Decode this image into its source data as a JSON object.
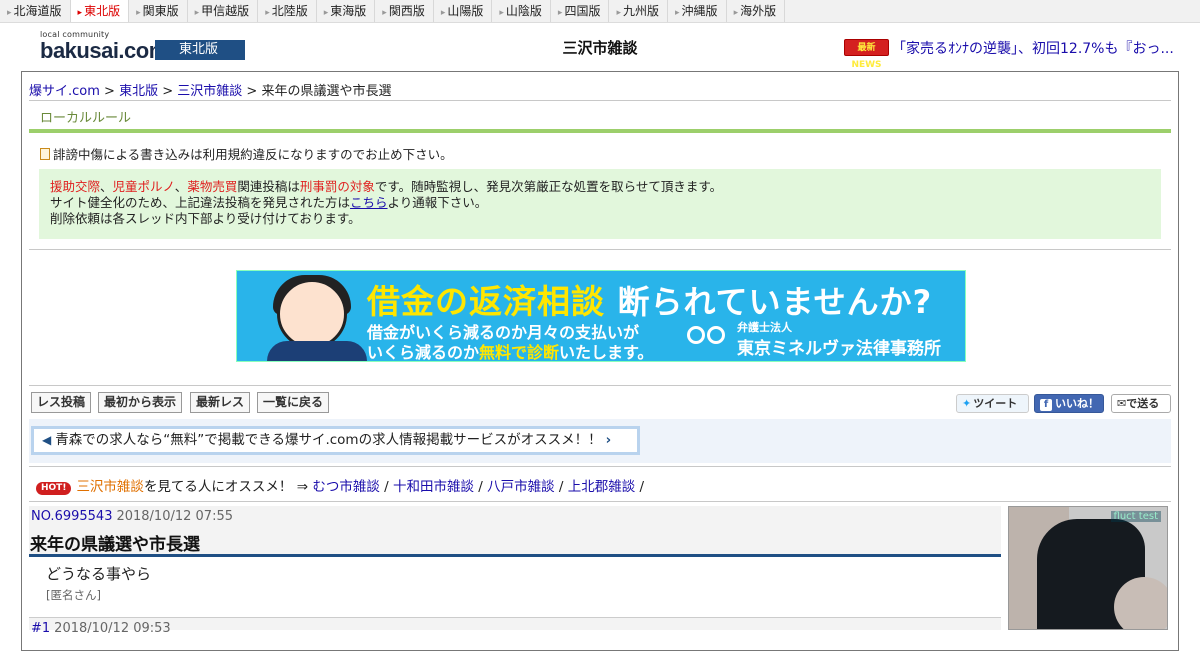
{
  "regions": [
    {
      "label": "北海道版",
      "active": false
    },
    {
      "label": "東北版",
      "active": true
    },
    {
      "label": "関東版",
      "active": false
    },
    {
      "label": "甲信越版",
      "active": false
    },
    {
      "label": "北陸版",
      "active": false
    },
    {
      "label": "東海版",
      "active": false
    },
    {
      "label": "関西版",
      "active": false
    },
    {
      "label": "山陽版",
      "active": false
    },
    {
      "label": "山陰版",
      "active": false
    },
    {
      "label": "四国版",
      "active": false
    },
    {
      "label": "九州版",
      "active": false
    },
    {
      "label": "沖縄版",
      "active": false
    },
    {
      "label": "海外版",
      "active": false
    }
  ],
  "header": {
    "logo_small": "local community",
    "logo_main": "bakusai.com",
    "region_badge": "東北版",
    "title": "三沢市雑談",
    "news_badge": "最新NEWS",
    "news_text": "「家売るｵﾝﾅの逆襲」、初回12.7%も『おっ..."
  },
  "breadcrumb": {
    "home": "爆サイ.com",
    "region": "東北版",
    "board": "三沢市雑談",
    "current": "来年の県議選や市長選",
    "sep": " > "
  },
  "local_rule": {
    "heading": "ローカルルール",
    "notice": "誹謗中傷による書き込みは利用規約違反になりますのでお止め下さい。",
    "warn_red1": "援助交際",
    "warn_red2": "児童ポルノ",
    "warn_red3": "薬物売買",
    "warn_mid": "関連投稿は",
    "warn_red4": "刑事罰の対象",
    "warn_tail": "です。随時監視し、発見次第厳正な処置を取らせて頂きます。",
    "line2_a": "サイト健全化のため、上記違法投稿を発見された方は",
    "line2_link": "こちら",
    "line2_b": "より通報下さい。",
    "line3": "削除依頼は各スレッド内下部より受け付けております。"
  },
  "ad": {
    "headline_yellow": "借金の返済相談",
    "headline_white": "断られていませんか?",
    "sub1": "借金がいくら減るのか月々の支払いが",
    "sub2_a": "いくら減るのか",
    "sub2_yellow": "無料で診断",
    "sub2_b": "いたします。",
    "firm_small": "弁護士法人",
    "firm": "東京ミネルヴァ法律事務所"
  },
  "actions": {
    "post": "レス投稿",
    "from_start": "最初から表示",
    "latest": "最新レス",
    "back": "一覧に戻る",
    "tweet": "ツイート",
    "like": "いいね！",
    "send": "で送る"
  },
  "job_promo": {
    "text": "青森での求人なら“無料”で掲載できる爆サイ.comの求人情報掲載サービスがオススメ！！"
  },
  "hot": {
    "badge": "HOT!",
    "board": "三沢市雑談",
    "text": "を見てる人にオススメ！ ⇒",
    "links": [
      "むつ市雑談",
      "十和田市雑談",
      "八戸市雑談",
      "上北郡雑談"
    ]
  },
  "thread": {
    "no": "NO.6995543",
    "date": "2018/10/12 07:55",
    "title": "来年の県議選や市長選",
    "body": "どうなる事やら",
    "author": "[匿名さん]",
    "reply_no": "#1",
    "reply_date": "2018/10/12 09:53"
  },
  "side_ad": {
    "caption": "fluct test"
  }
}
